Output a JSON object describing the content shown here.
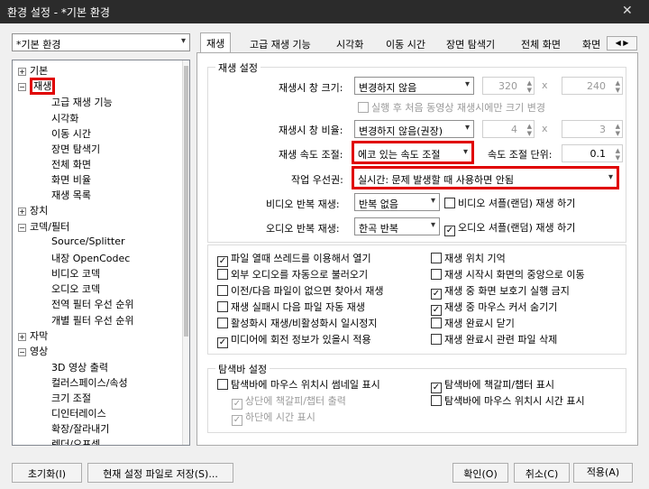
{
  "window": {
    "title": "환경 설정 - *기본 환경"
  },
  "preset": {
    "value": "*기본 환경"
  },
  "tree": {
    "items": [
      "기본",
      "재생",
      "고급 재생 기능",
      "시각화",
      "이동 시간",
      "장면 탐색기",
      "전체 화면",
      "화면 비율",
      "재생 목록",
      "장치",
      "코덱/필터",
      "Source/Splitter",
      "내장 OpenCodec",
      "비디오 코덱",
      "오디오 코덱",
      "전역 필터 우선 순위",
      "개별 필터 우선 순위",
      "자막",
      "영상",
      "3D 영상 출력",
      "컬러스페이스/속성",
      "크기 조절",
      "디인터레이스",
      "확장/잘라내기",
      "렌더/오프셋"
    ]
  },
  "tabs": [
    "재생",
    "고급 재생 기능",
    "시각화",
    "이동 시간",
    "장면 탐색기",
    "전체 화면",
    "화면"
  ],
  "playback": {
    "group_title": "재생 설정",
    "window_size_label": "재생시 창 크기:",
    "window_size_value": "변경하지 않음",
    "width": "320",
    "height": "240",
    "x": "x",
    "first_video_only": "실행 후 처음 동영상 재생시에만 크기 변경",
    "ratio_label": "재생시 창 비율:",
    "ratio_value": "변경하지 않음(권장)",
    "ratio_w": "4",
    "ratio_h": "3",
    "speed_label": "재생 속도 조절:",
    "speed_value": "에코 있는 속도 조절",
    "speed_unit_label": "속도 조절 단위:",
    "speed_unit_value": "0.1",
    "priority_label": "작업 우선권:",
    "priority_value": "실시간: 문제 발생할 때 사용하면 안됨",
    "video_repeat_label": "비디오 반복 재생:",
    "video_repeat_value": "반복 없음",
    "video_shuffle": "비디오 셔플(랜덤) 재생 하기",
    "audio_repeat_label": "오디오 반복 재생:",
    "audio_repeat_value": "한곡 반복",
    "audio_shuffle": "오디오 셔플(랜덤) 재생 하기"
  },
  "options_left": [
    {
      "label": "파일 열때 쓰레드를 이용해서 열기",
      "checked": true
    },
    {
      "label": "외부 오디오를 자동으로 불러오기",
      "checked": false
    },
    {
      "label": "이전/다음 파일이 없으면 찾아서 재생",
      "checked": false
    },
    {
      "label": "재생 실패시 다음 파일 자동 재생",
      "checked": false
    },
    {
      "label": "활성화시 재생/비활성화시 일시정지",
      "checked": false
    },
    {
      "label": "미디어에 회전 정보가 있을시 적용",
      "checked": true
    }
  ],
  "options_right": [
    {
      "label": "재생 위치 기억",
      "checked": false
    },
    {
      "label": "재생 시작시 화면의 중앙으로 이동",
      "checked": false
    },
    {
      "label": "재생 중 화면 보호기 실행 금지",
      "checked": true
    },
    {
      "label": "재생 중 마우스 커서 숨기기",
      "checked": true
    },
    {
      "label": "재생 완료시 닫기",
      "checked": false
    },
    {
      "label": "재생 완료시 관련 파일 삭제",
      "checked": false
    }
  ],
  "seekbar": {
    "group_title": "탐색바 설정",
    "thumb_preview": "탐색바에 마우스 위치시 썸네일 표시",
    "chapter_upper": "상단에 책갈피/챕터 출력",
    "time_lower": "하단에 시간 표시",
    "chapter_show": "탐색바에 책갈피/챕터 표시",
    "time_show": "탐색바에 마우스 위치시 시간 표시"
  },
  "buttons": {
    "reset": "초기화(I)",
    "save_as": "현재 설정 파일로 저장(S)...",
    "ok": "확인(O)",
    "cancel": "취소(C)",
    "apply": "적용(A)"
  },
  "check_glyph": "✓"
}
